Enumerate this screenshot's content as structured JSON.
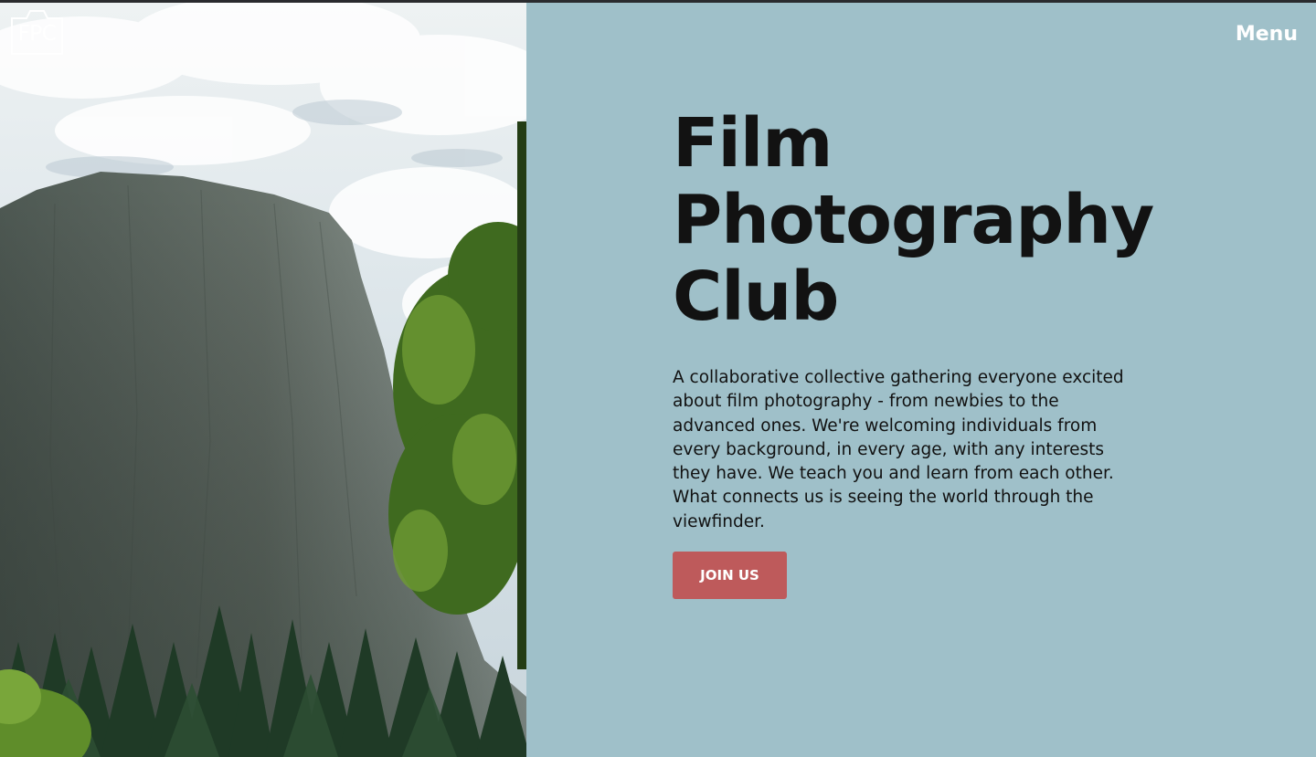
{
  "logo": {
    "text": "FPC"
  },
  "nav": {
    "menu_label": "Menu"
  },
  "hero": {
    "title_lines": [
      "Film",
      "Photography",
      "Club"
    ],
    "description": "A collaborative collective gathering everyone excited about film photography - from newbies to the advanced ones. We're welcoming individuals from every background, in every age, with any interests they have. We teach you and learn from each other. What connects us is seeing the world through the viewfinder.",
    "cta_label": "JOIN US"
  },
  "colors": {
    "panel_background": "#9fc0c9",
    "cta_background": "#be5a5b",
    "title_text": "#121212",
    "menu_text": "#ffffff"
  },
  "photo": {
    "icon": "mountain-landscape-photo"
  }
}
